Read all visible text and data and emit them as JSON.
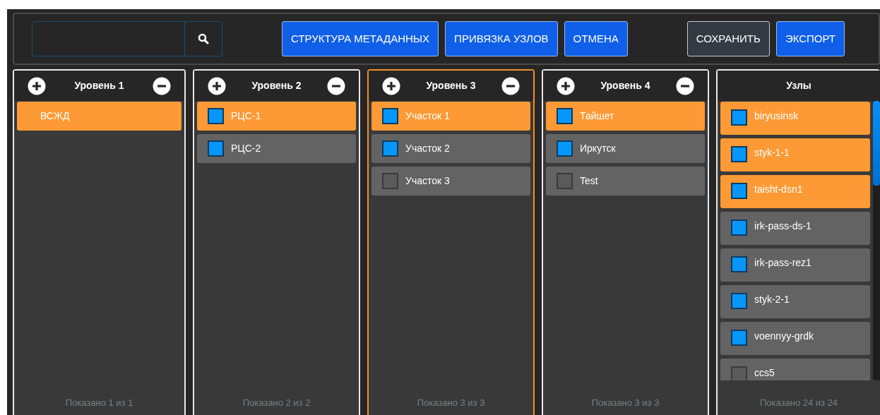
{
  "toolbar": {
    "buttons": [
      {
        "label": "СТРУКТУРА МЕТАДАННЫХ",
        "kind": "primary"
      },
      {
        "label": "ПРИВЯЗКА УЗЛОВ",
        "kind": "primary"
      },
      {
        "label": "ОТМЕНА",
        "kind": "primary"
      },
      {
        "label": "СОХРАНИТЬ",
        "kind": "secondary"
      },
      {
        "label": "ЭКСПОРТ",
        "kind": "primary"
      }
    ]
  },
  "columns": [
    {
      "kind": "level",
      "title": "Уровень 1",
      "active": false,
      "footer": "Показано 1 из 1",
      "items": [
        {
          "kind": "plain",
          "label": "ВСЖД",
          "selected": true
        }
      ]
    },
    {
      "kind": "level",
      "title": "Уровень 2",
      "active": false,
      "footer": "Показано 2 из 2",
      "items": [
        {
          "kind": "checkbox",
          "label": "РЦС-1",
          "selected": true,
          "checked": true
        },
        {
          "kind": "checkbox",
          "label": "РЦС-2",
          "selected": false,
          "checked": true
        }
      ]
    },
    {
      "kind": "level",
      "title": "Уровень 3",
      "active": true,
      "footer": "Показано 3 из 3",
      "items": [
        {
          "kind": "checkbox",
          "label": "Участок 1",
          "selected": true,
          "checked": true
        },
        {
          "kind": "checkbox",
          "label": "Участок 2",
          "selected": false,
          "checked": true
        },
        {
          "kind": "checkbox",
          "label": "Участок 3",
          "selected": false,
          "checked": false
        }
      ]
    },
    {
      "kind": "level",
      "title": "Уровень 4",
      "active": false,
      "footer": "Показано 3 из 3",
      "items": [
        {
          "kind": "checkbox",
          "label": "Тайшет",
          "selected": true,
          "checked": true
        },
        {
          "kind": "checkbox",
          "label": "Иркутск",
          "selected": false,
          "checked": true
        },
        {
          "kind": "checkbox",
          "label": "Test",
          "selected": false,
          "checked": false
        }
      ]
    },
    {
      "kind": "nodes",
      "title": "Узлы",
      "active": false,
      "footer": "Показано 24 из 24",
      "items": [
        {
          "kind": "checkbox",
          "label": "biryusinsk",
          "selected": true,
          "checked": true
        },
        {
          "kind": "checkbox",
          "label": "styk-1-1",
          "selected": true,
          "checked": true
        },
        {
          "kind": "checkbox",
          "label": "taisht-dsn1",
          "selected": true,
          "checked": true
        },
        {
          "kind": "checkbox",
          "label": "irk-pass-ds-1",
          "selected": false,
          "checked": true
        },
        {
          "kind": "checkbox",
          "label": "irk-pass-rez1",
          "selected": false,
          "checked": true
        },
        {
          "kind": "checkbox",
          "label": "styk-2-1",
          "selected": false,
          "checked": true
        },
        {
          "kind": "checkbox",
          "label": "voennyy-grdk",
          "selected": false,
          "checked": true
        },
        {
          "kind": "checkbox",
          "label": "ccs5",
          "selected": false,
          "checked": false
        }
      ]
    }
  ]
}
